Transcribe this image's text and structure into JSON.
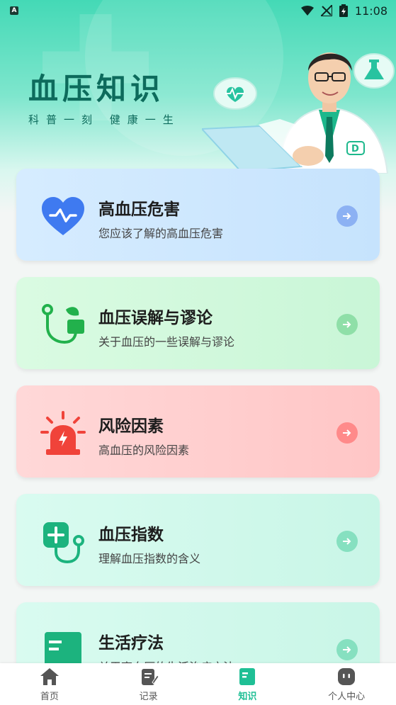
{
  "status_bar": {
    "time": "11:08",
    "indicator": "A"
  },
  "hero": {
    "title": "血压知识",
    "subtitle": "科普一刻 健康一生"
  },
  "cards": [
    {
      "title": "高血压危害",
      "desc": "您应该了解的高血压危害",
      "icon": "heart-pulse-icon",
      "accent": "#3f7af0"
    },
    {
      "title": "血压误解与谬论",
      "desc": "关于血压的一些误解与谬论",
      "icon": "stethoscope-icon",
      "accent": "#22b14c"
    },
    {
      "title": "风险因素",
      "desc": "高血压的风险因素",
      "icon": "alarm-icon",
      "accent": "#f0433a"
    },
    {
      "title": "血压指数",
      "desc": "理解血压指数的含义",
      "icon": "stethoscope-plus-icon",
      "accent": "#1cb37e"
    },
    {
      "title": "生活疗法",
      "desc": "关于高血压的生活治疗方法",
      "icon": "book-icon",
      "accent": "#1cb37e"
    }
  ],
  "tabs": [
    {
      "label": "首页",
      "icon": "home-icon",
      "active": false
    },
    {
      "label": "记录",
      "icon": "record-icon",
      "active": false
    },
    {
      "label": "知识",
      "icon": "knowledge-book-icon",
      "active": true
    },
    {
      "label": "个人中心",
      "icon": "profile-icon",
      "active": false
    }
  ],
  "colors": {
    "primary": "#1fbf95",
    "hero_text": "#0d6b5c"
  }
}
